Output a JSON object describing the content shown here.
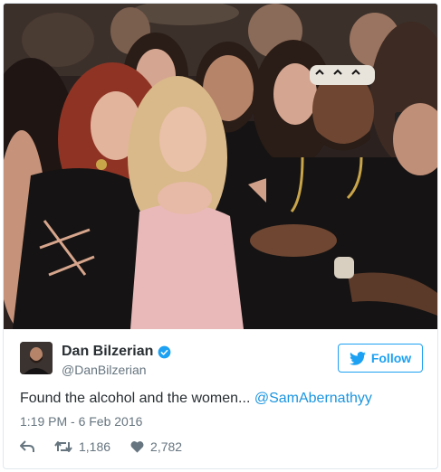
{
  "photo": {
    "alt_subject": "group-photo",
    "palette": {
      "background": "#2b2220",
      "club_lights": "#6b5a4d",
      "skin": "#c9967b",
      "dark_skin": "#6e4632",
      "red_hair": "#8f3424",
      "blonde_hair": "#d9b98a",
      "dark_hair": "#2a1c16",
      "black_clothing": "#151313",
      "pink_dress": "#e9b9ba",
      "gold_accent": "#c9a54a",
      "white_bandana": "#e8e4dc"
    }
  },
  "tweet": {
    "display_name": "Dan Bilzerian",
    "handle": "@DanBilzerian",
    "verified_icon": "verified-badge",
    "follow_label": "Follow",
    "text": "Found the alcohol and the women... ",
    "mention": "@SamAbernathyy",
    "timestamp": "1:19 PM - 6 Feb 2016",
    "retweets": "1,186",
    "likes": "2,782"
  },
  "colors": {
    "accent": "#1da1f2",
    "link": "#1b95e0",
    "text": "#292f33",
    "muted": "#66757f",
    "border": "#e1e8ed"
  }
}
